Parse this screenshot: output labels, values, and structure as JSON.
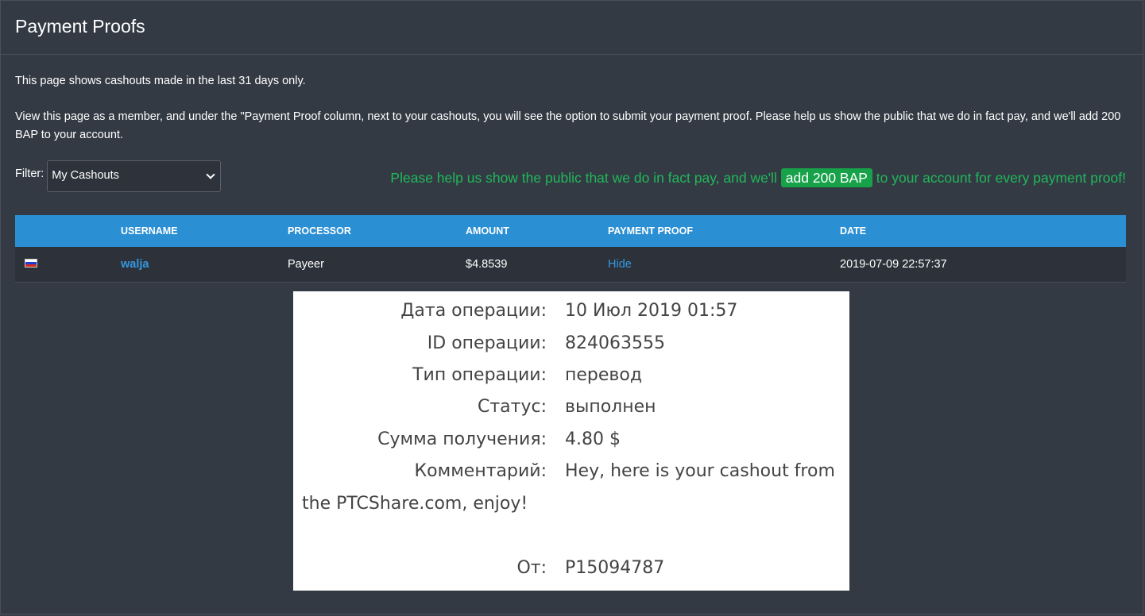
{
  "page": {
    "title": "Payment Proofs",
    "intro_1": "This page shows cashouts made in the last 31 days only.",
    "intro_2": "View this page as a member, and under the \"Payment Proof column, next to your cashouts, you will see the option to submit your payment proof. Please help us show the public that we do in fact pay, and we'll add 200 BAP to your account."
  },
  "filter": {
    "label": "Filter:",
    "selected": "My Cashouts"
  },
  "promo": {
    "before": "Please help us show the public that we do in fact pay, and we'll ",
    "badge": "add 200 BAP",
    "after": " to your account for every payment proof!"
  },
  "table": {
    "headers": [
      "USERNAME",
      "PROCESSOR",
      "AMOUNT",
      "PAYMENT PROOF",
      "DATE"
    ],
    "rows": [
      {
        "country": "Russia",
        "username": "walja",
        "processor": "Payeer",
        "amount": "$4.8539",
        "payment_proof": "Hide",
        "date": "2019-07-09 22:57:37"
      }
    ]
  },
  "proof_image": {
    "date_label": "Дата операции:",
    "date_value": "10 Июл 2019 01:57",
    "id_label": "ID операции:",
    "id_value": "824063555",
    "type_label": "Тип операции:",
    "type_value": "перевод",
    "status_label": "Статус:",
    "status_value": "выполнен",
    "sum_label": "Сумма получения:",
    "sum_value": "4.80 $",
    "comment_label": "Комментарий:",
    "comment_value": "Hey, here is your cashout from",
    "comment_cont": "the PTCShare.com, enjoy!",
    "from_label": "От:",
    "from_value": "P15094787"
  },
  "colors": {
    "background": "#343a44",
    "table_header": "#2b8fd4",
    "link": "#3498e0",
    "promo_green": "#1fb85a",
    "badge_green": "#17a24a"
  }
}
